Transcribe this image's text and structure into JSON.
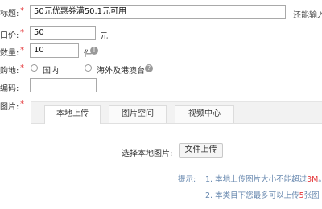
{
  "form": {
    "title_label": "标题:",
    "title_value": "50元优惠券满50.1元可用",
    "title_hint": "还能输入",
    "price_label": "口价:",
    "price_value": "50",
    "price_unit": "元",
    "qty_label": "数量:",
    "qty_value": "10",
    "qty_unit": "件",
    "region_label": "购地:",
    "region_domestic": "国内",
    "region_overseas": "海外及港澳台",
    "code_label": "编码:",
    "code_value": "",
    "image_label": "图片:",
    "required_mark": "*"
  },
  "upload": {
    "tabs": [
      "本地上传",
      "图片空间",
      "视频中心"
    ],
    "active_tab": 0,
    "select_label": "选择本地图片:",
    "button_label": "文件上传",
    "tip_label": "提示:",
    "tip1_prefix": "1. 本地上传图片大小不能超过",
    "tip1_value": "3M",
    "tip1_suffix": "。",
    "tip2_prefix": "2. 本类目下您最多可以上传",
    "tip2_value": "5",
    "tip2_suffix": "张图"
  },
  "colors": {
    "required": "#e4393c",
    "tip_text": "#6a8ab0"
  }
}
